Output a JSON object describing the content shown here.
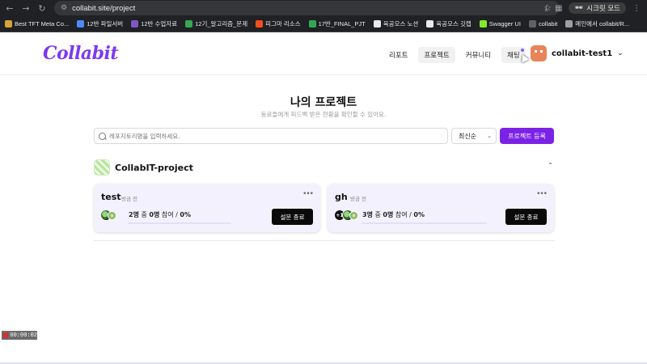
{
  "browser": {
    "url": "collabit.site/project",
    "incognito_label": "시크릿 모드",
    "bookmarks": [
      {
        "label": "Best TFT Meta Co...",
        "color": "#d8a23a"
      },
      {
        "label": "12반 파일서버",
        "color": "#4c8bf5"
      },
      {
        "label": "12반 수업자료",
        "color": "#7e57c2"
      },
      {
        "label": "12기_알고리즘_문제",
        "color": "#34a853"
      },
      {
        "label": "피그마 리소스",
        "color": "#f24e1e"
      },
      {
        "label": "17반_FINAL_PJT",
        "color": "#34a853"
      },
      {
        "label": "육공오스 노션",
        "color": "#e8eaed"
      },
      {
        "label": "육공오스 깃랩",
        "color": "#e8eaed"
      },
      {
        "label": "Swagger UI",
        "color": "#85ea2d"
      },
      {
        "label": "collabit",
        "color": "#5f6368"
      },
      {
        "label": "메인에서 collabit/R...",
        "color": "#9aa0a6"
      }
    ]
  },
  "header": {
    "logo": "Collabit",
    "nav": [
      {
        "label": "리포트"
      },
      {
        "label": "프로젝트"
      },
      {
        "label": "커뮤니티"
      },
      {
        "label": "채팅"
      }
    ],
    "username": "collabit-test1"
  },
  "page": {
    "title": "나의 프로젝트",
    "subtitle": "동료들에게 피드백 받은 현황을 확인할 수 있어요.",
    "search_placeholder": "레포지토리명을 입력하세요.",
    "sort_label": "최신순",
    "register_label": "프로젝트 등록"
  },
  "group": {
    "name": "CollabIT-project"
  },
  "cards": [
    {
      "title": "test",
      "status": "방금 전",
      "total": "2명",
      "mid": " 중 ",
      "joined": "0명",
      "suffix": " 참여 / ",
      "percent": "0%",
      "progress": 0,
      "end_label": "설문 종료",
      "extra_avatars": ""
    },
    {
      "title": "gh",
      "status": "방금 전",
      "total": "3명",
      "mid": " 중 ",
      "joined": "0명",
      "suffix": " 참여 / ",
      "percent": "0%",
      "progress": 0,
      "end_label": "설문 종료",
      "extra_avatars": "+1"
    }
  ],
  "recorder": {
    "time": "00:00:02"
  }
}
